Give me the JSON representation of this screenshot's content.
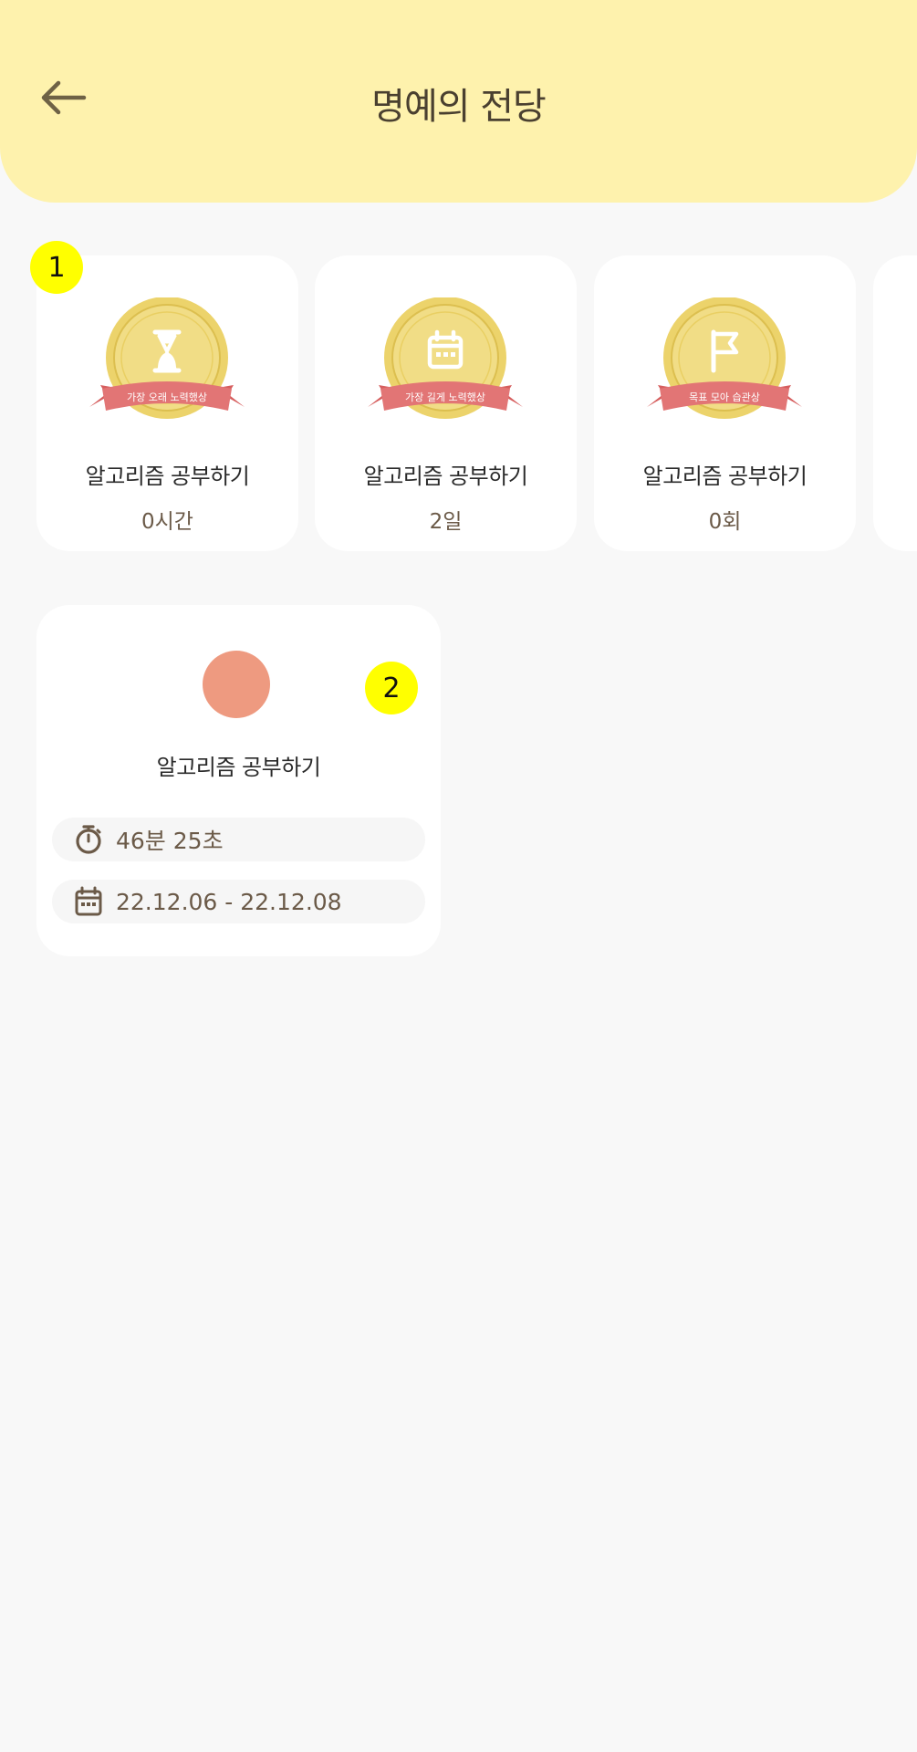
{
  "header": {
    "title": "명예의 전당",
    "back_icon": "arrow-left-icon",
    "background": "#fef2ad"
  },
  "markers": [
    "1",
    "2"
  ],
  "awards": [
    {
      "badge_text": "가장 오래 노력했상",
      "icon": "hourglass-icon",
      "goal": "알고리즘 공부하기",
      "value": "0시간"
    },
    {
      "badge_text": "가장 길게 노력했상",
      "icon": "calendar-icon",
      "goal": "알고리즘 공부하기",
      "value": "2일"
    },
    {
      "badge_text": "목표 모아 습관상",
      "icon": "flag-icon",
      "goal": "알고리즘 공부하기",
      "value": "0회"
    }
  ],
  "record": {
    "color": "#ee9a80",
    "goal": "알고리즘 공부하기",
    "duration": "46분 25초",
    "duration_icon": "stopwatch-icon",
    "period": "22.12.06 - 22.12.08",
    "period_icon": "calendar-icon"
  },
  "colors": {
    "medal_gold": "#e8c955",
    "ribbon": "#e27575",
    "text_brown": "#6b5a48"
  }
}
